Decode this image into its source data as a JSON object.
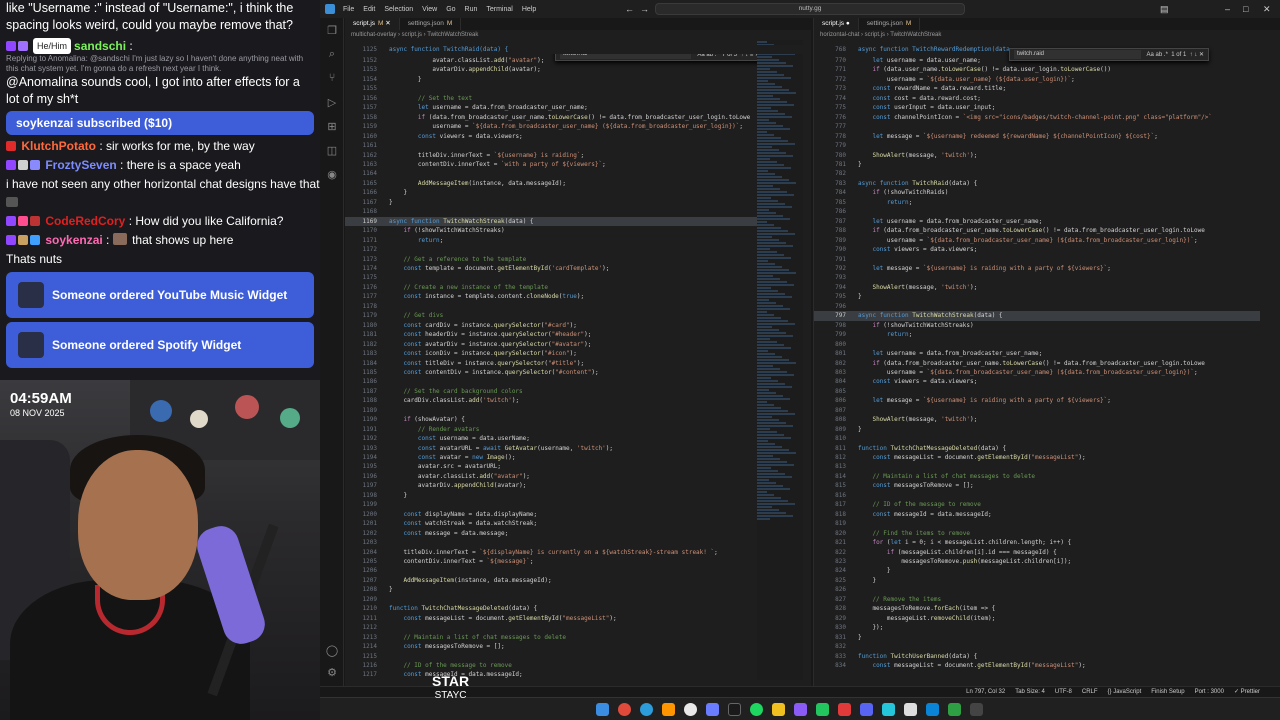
{
  "chat": {
    "line1": "like \"Username :\" instead of \"Username:\", i think the spacing looks weird, could you maybe remove that?",
    "m2": {
      "user": "sandschi",
      "pill": "He/Him",
      "sep": " :"
    },
    "m2_reply": "Replying to Anomalina: @sandschi I'm just lazy so I haven't done anything neat with this chat system yet. I'm gonna do a refresh next year I think.",
    "m3": "@Anomalina sounds cool, I got into after effects for a lot of my sh*t",
    "sub": "soykenzai subscribed ($10)",
    "m4": {
      "user": "KlutchPotato",
      "text": " : sir works for me, by the way"
    },
    "m5": {
      "user": "FroztySeven",
      "text": " : there is a space yeah"
    },
    "m6": "i have not seen any other horizontal chat designs have that",
    "m7": {
      "user": "CodeRedCory",
      "text": " : How did you like California?"
    },
    "m8": {
      "user": "soykenzai",
      "text": " that shows up here"
    },
    "m9": "Thats nuts",
    "alert1": "Someone ordered YouTube Music Widget",
    "alert2": "Someone ordered Spotify Widget"
  },
  "cam": {
    "time": "04:59AM",
    "date": "08 NOV 2025"
  },
  "song": {
    "title": "STAR",
    "artist": "STAYC"
  },
  "titlebar": {
    "menus": [
      "File",
      "Edit",
      "Selection",
      "View",
      "Go",
      "Run",
      "Terminal",
      "Help"
    ],
    "search": "nutty.gg"
  },
  "left_editor": {
    "tabs": [
      "script.js",
      "settings.json"
    ],
    "tab_marks": [
      "M",
      "M"
    ],
    "breadcrumb": "multichat-overlay › script.js › TwitchWatchStreak",
    "find": {
      "query": "twitchRai",
      "count": "7 of 5"
    },
    "sticky": "async function TwitchRaid(data) {",
    "sticky_ln": "1125"
  },
  "right_editor": {
    "tabs": [
      "script.js",
      "settings.json"
    ],
    "tab_marks": [
      "",
      "M"
    ],
    "breadcrumb": "horizontal-chat › script.js › TwitchWatchStreak",
    "find": {
      "query": "twitch.raid",
      "count": "1 of 1"
    },
    "sticky": "async function TwitchRewardRedemption(data",
    "sticky_ln": "768"
  },
  "status": {
    "items": [
      "Ln 797, Col 32",
      "Tab Size: 4",
      "UTF-8",
      "CRLF",
      "{} JavaScript",
      "Finish Setup",
      "Port : 3000",
      "✓ Prettier"
    ]
  }
}
